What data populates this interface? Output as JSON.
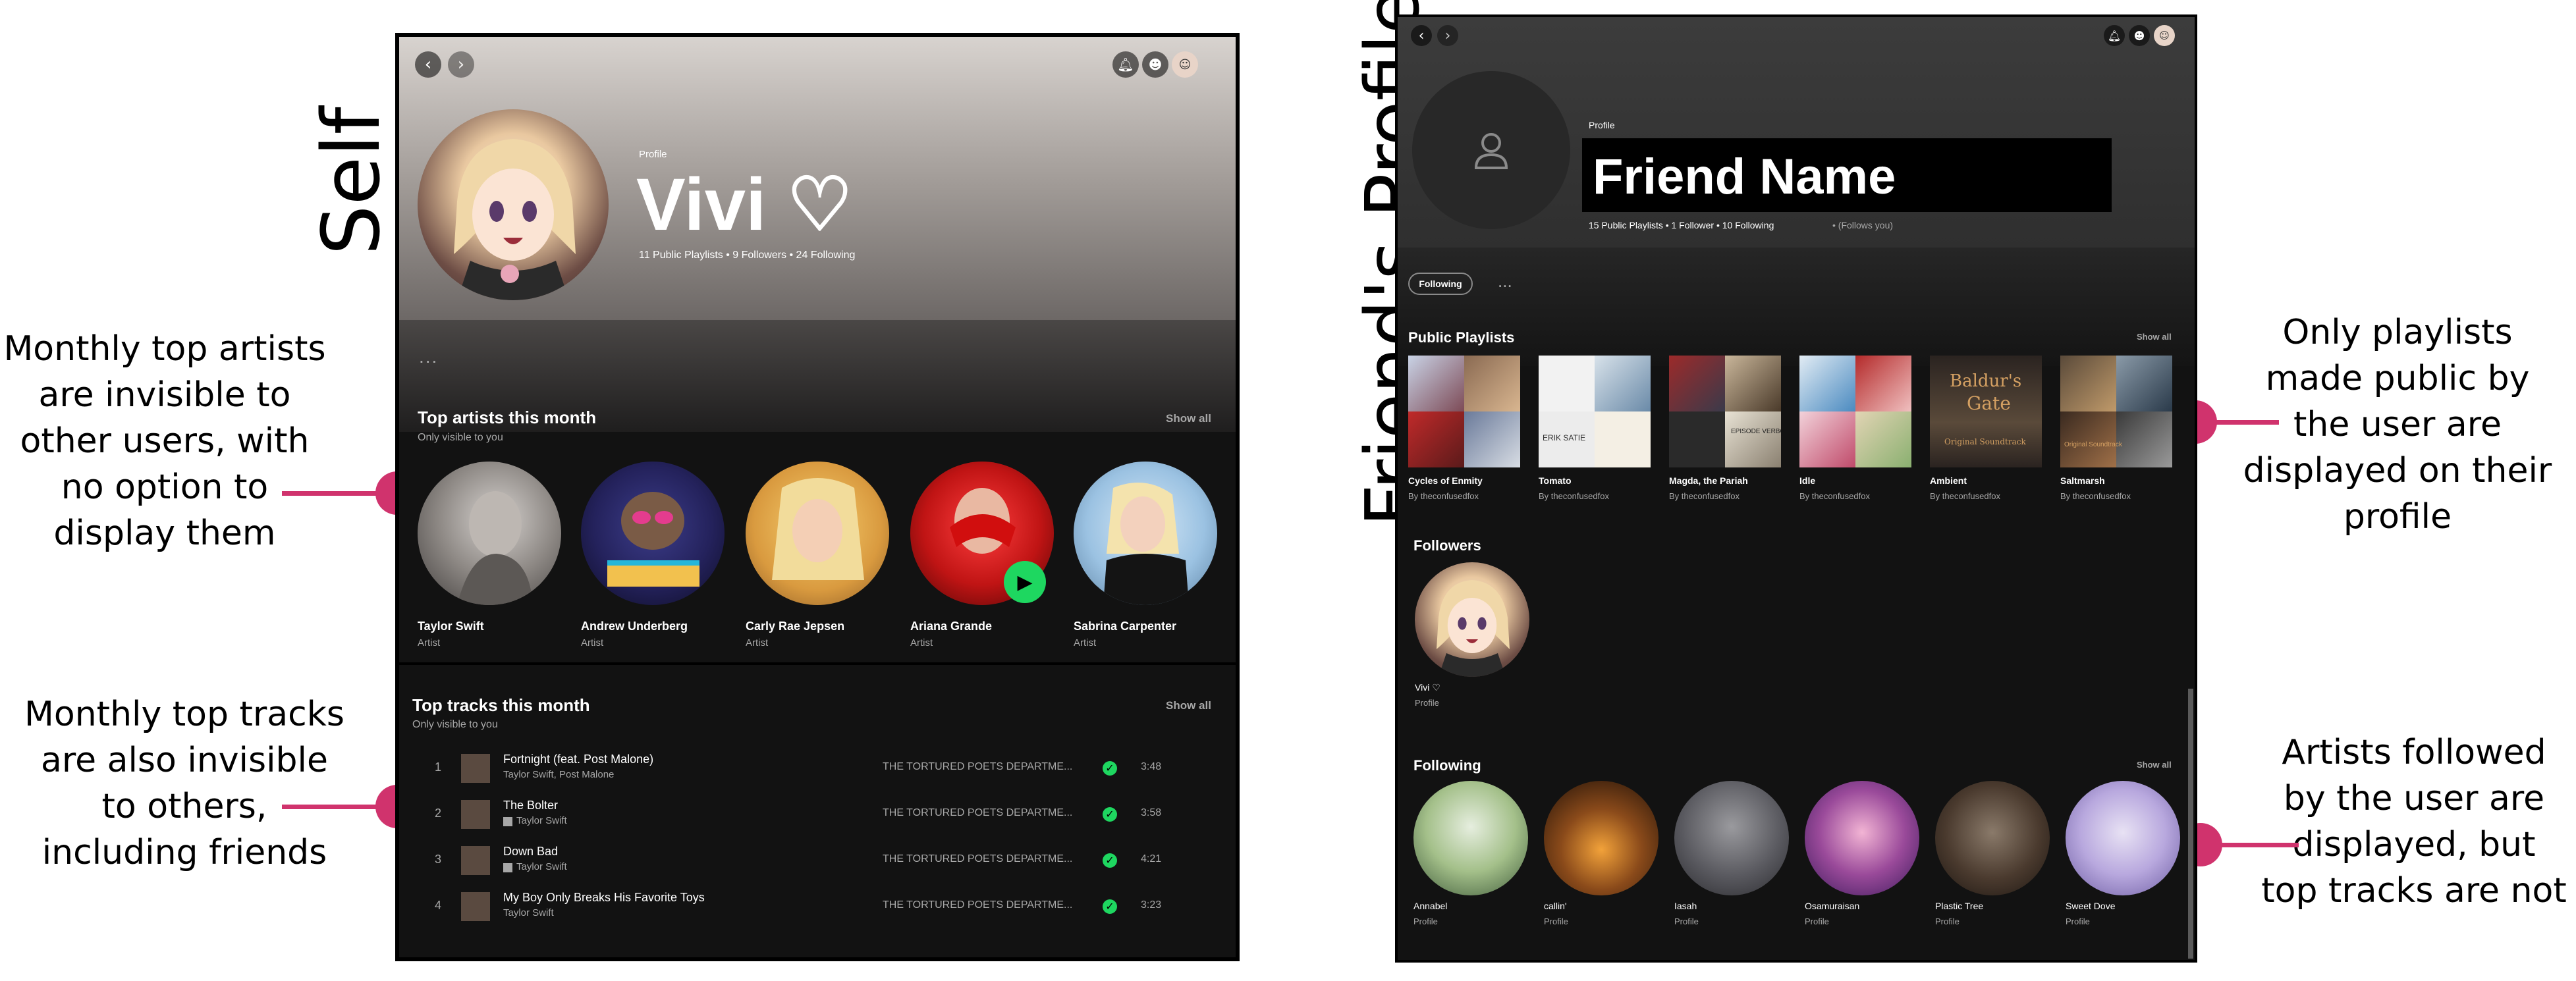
{
  "labels": {
    "self": "Self",
    "friend": "Friend's Profile"
  },
  "annotations": {
    "artists": [
      "Monthly top artists",
      "are invisible to",
      "other users, with",
      "no option to",
      "display them"
    ],
    "tracks": [
      "Monthly top tracks",
      "are also invisible",
      "to others,",
      "including friends"
    ],
    "playlists": [
      "Only playlists",
      "made public by",
      "the user are",
      "displayed on their",
      "profile"
    ],
    "following": [
      "Artists followed",
      "by the user are",
      "displayed, but",
      "top tracks are not"
    ]
  },
  "self": {
    "header": {
      "type": "Profile",
      "name": "Vivi ♡",
      "stats": "11 Public Playlists • 9 Followers • 24 Following"
    },
    "more": "...",
    "top_artists": {
      "title": "Top artists this month",
      "subtitle": "Only visible to you",
      "show_all": "Show all",
      "items": [
        {
          "name": "Taylor Swift",
          "role": "Artist"
        },
        {
          "name": "Andrew Underberg",
          "role": "Artist"
        },
        {
          "name": "Carly Rae Jepsen",
          "role": "Artist"
        },
        {
          "name": "Ariana Grande",
          "role": "Artist"
        },
        {
          "name": "Sabrina Carpenter",
          "role": "Artist"
        }
      ]
    },
    "top_tracks": {
      "title": "Top tracks this month",
      "subtitle": "Only visible to you",
      "show_all": "Show all",
      "items": [
        {
          "num": "1",
          "title": "Fortnight (feat. Post Malone)",
          "artist": "Taylor Swift, Post Malone",
          "album": "THE TORTURED POETS DEPARTME...",
          "duration": "3:48",
          "explicit": false
        },
        {
          "num": "2",
          "title": "The Bolter",
          "artist": "Taylor Swift",
          "album": "THE TORTURED POETS DEPARTME...",
          "duration": "3:58",
          "explicit": true
        },
        {
          "num": "3",
          "title": "Down Bad",
          "artist": "Taylor Swift",
          "album": "THE TORTURED POETS DEPARTME...",
          "duration": "4:21",
          "explicit": true
        },
        {
          "num": "4",
          "title": "My Boy Only Breaks His Favorite Toys",
          "artist": "Taylor Swift",
          "album": "THE TORTURED POETS DEPARTME...",
          "duration": "3:23",
          "explicit": false
        }
      ]
    }
  },
  "friend": {
    "header": {
      "type": "Profile",
      "name": "Friend Name",
      "stats": "15 Public Playlists • 1 Follower • 10 Following",
      "follows_you": "• (Follows you)"
    },
    "following_button": "Following",
    "more": "...",
    "playlists": {
      "title": "Public Playlists",
      "show_all": "Show all",
      "items": [
        {
          "name": "Cycles of Enmity",
          "owner": "By theconfusedfox"
        },
        {
          "name": "Tomato",
          "owner": "By theconfusedfox"
        },
        {
          "name": "Magda, the Pariah",
          "owner": "By theconfusedfox"
        },
        {
          "name": "Idle",
          "owner": "By theconfusedfox"
        },
        {
          "name": "Ambient",
          "owner": "By theconfusedfox"
        },
        {
          "name": "Saltmarsh",
          "owner": "By theconfusedfox"
        }
      ],
      "cover_text": {
        "tomato": "ERIK SATIE",
        "magda": "EPISODE VERBOS",
        "ambient_top": "Baldur's",
        "ambient_mid": "Gate",
        "ambient_bottom": "Original Soundtrack",
        "saltmarsh": "Original Soundtrack"
      }
    },
    "followers": {
      "title": "Followers",
      "items": [
        {
          "name": "Vivi ♡",
          "role": "Profile"
        }
      ]
    },
    "following": {
      "title": "Following",
      "show_all": "Show all",
      "items": [
        {
          "name": "Annabel",
          "role": "Profile"
        },
        {
          "name": "callin'",
          "role": "Profile"
        },
        {
          "name": "Iasah",
          "role": "Profile"
        },
        {
          "name": "Osamuraisan",
          "role": "Profile"
        },
        {
          "name": "Plastic Tree",
          "role": "Profile"
        },
        {
          "name": "Sweet Dove",
          "role": "Profile"
        }
      ]
    }
  },
  "colors": {
    "accent": "#1ed760",
    "callout": "#d0336d",
    "background": "#121212"
  }
}
